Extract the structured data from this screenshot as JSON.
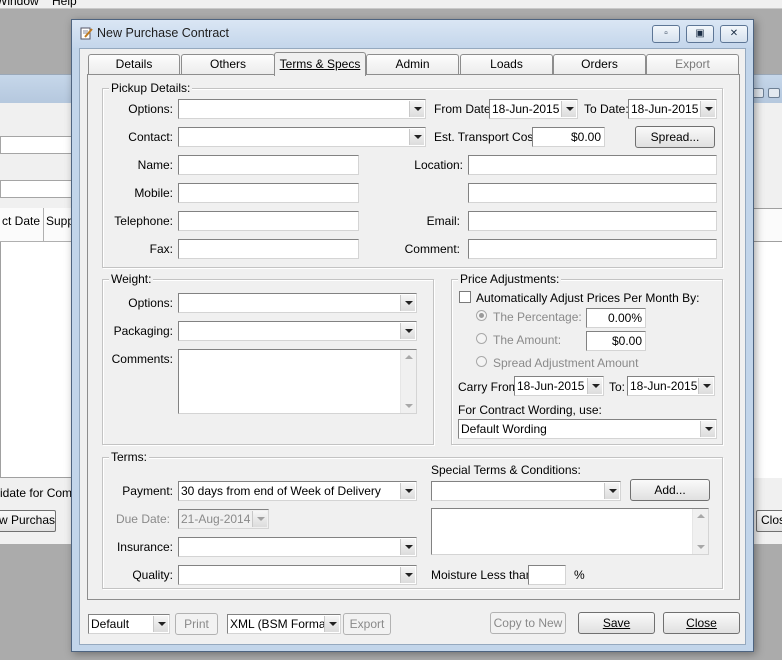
{
  "background_app": {
    "menu": [
      "Window",
      "Help"
    ],
    "grid_headers": [
      "ct Date",
      "Supp"
    ],
    "status_text": "idate for Comple",
    "new_purchase_button": "w Purchase",
    "close_button": "Clos"
  },
  "dialog": {
    "title": "New Purchase Contract",
    "tabs": [
      "Details",
      "Others",
      "Terms & Specs",
      "Admin",
      "Loads",
      "Orders",
      "Export"
    ],
    "active_tab": "Terms & Specs"
  },
  "pickup": {
    "title": "Pickup Details:",
    "options_label": "Options:",
    "options_value": "",
    "contact_label": "Contact:",
    "contact_value": "",
    "name_label": "Name:",
    "mobile_label": "Mobile:",
    "telephone_label": "Telephone:",
    "fax_label": "Fax:",
    "from_date_label": "From Date:",
    "from_date": "18-Jun-2015",
    "to_date_label": "To Date:",
    "to_date": "18-Jun-2015",
    "transport_cost_label": "Est. Transport Cost:",
    "transport_cost": "$0.00",
    "spread_button": "Spread...",
    "location_label": "Location:",
    "email_label": "Email:",
    "comment_label": "Comment:"
  },
  "weight": {
    "title": "Weight:",
    "options_label": "Options:",
    "packaging_label": "Packaging:",
    "comments_label": "Comments:"
  },
  "price_adjustments": {
    "title": "Price Adjustments:",
    "auto_adjust_label": "Automatically Adjust Prices Per Month By:",
    "percentage_label": "The Percentage:",
    "percentage_value": "0.00%",
    "amount_label": "The Amount:",
    "amount_value": "$0.00",
    "spread_label": "Spread Adjustment Amount",
    "carry_from_label": "Carry From:",
    "carry_from": "18-Jun-2015",
    "carry_to_label": "To:",
    "carry_to": "18-Jun-2015",
    "wording_label": "For Contract Wording, use:",
    "wording_value": "Default Wording"
  },
  "terms": {
    "title": "Terms:",
    "payment_label": "Payment:",
    "payment_value": "30 days from end of Week of Delivery",
    "due_date_label": "Due Date:",
    "due_date": "21-Aug-2014",
    "insurance_label": "Insurance:",
    "quality_label": "Quality:",
    "special_terms_label": "Special Terms & Conditions:",
    "add_button": "Add...",
    "moisture_label": "Moisture Less than:",
    "moisture_unit": "%"
  },
  "footer": {
    "report_select": "Default",
    "print_button": "Print",
    "format_select": "XML (BSM Format)",
    "export_button": "Export",
    "copy_button": "Copy to New",
    "save_button": "Save",
    "close_button": "Close"
  },
  "colors": {
    "dialog_frame": "#c2d5ea",
    "client_bg": "#f0f0f0",
    "screen_bg": "#ababab"
  }
}
